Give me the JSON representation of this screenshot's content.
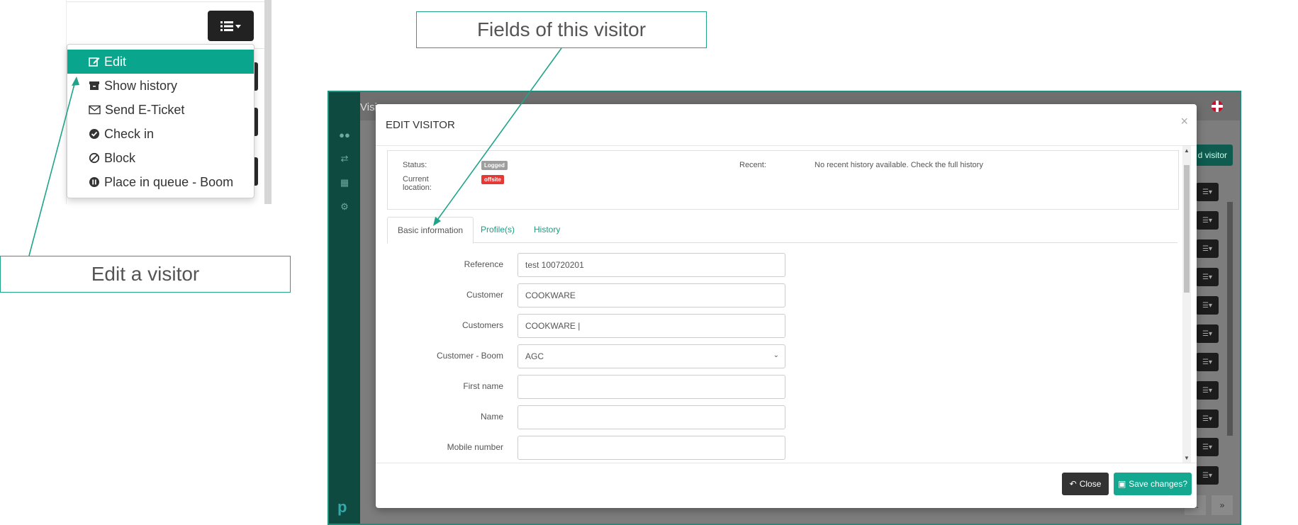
{
  "dropdown": {
    "items": [
      {
        "label": "Edit",
        "icon": "edit-icon"
      },
      {
        "label": "Show history",
        "icon": "archive-icon"
      },
      {
        "label": "Send E-Ticket",
        "icon": "envelope-icon"
      },
      {
        "label": "Check in",
        "icon": "check-circle-icon"
      },
      {
        "label": "Block",
        "icon": "ban-icon"
      },
      {
        "label": "Place in queue - Boom",
        "icon": "pause-circle-icon"
      }
    ]
  },
  "annotations": {
    "edit_visitor": "Edit a visitor",
    "fields_visitor": "Fields of this visitor"
  },
  "app": {
    "title": "Visi",
    "add_visitor": "d visitor",
    "pager_next": "»",
    "pager_ellipsis": "..."
  },
  "modal": {
    "title": "EDIT VISITOR",
    "close_symbol": "×",
    "status": {
      "status_label": "Status:",
      "status_badge": "Logged",
      "location_label": "Current location:",
      "location_badge": "offsite",
      "recent_label": "Recent:",
      "recent_text": "No recent history available. Check the full history"
    },
    "tabs": [
      {
        "label": "Basic information",
        "active": true
      },
      {
        "label": "Profile(s)",
        "active": false
      },
      {
        "label": "History",
        "active": false
      }
    ],
    "fields": [
      {
        "label": "Reference",
        "value": "test 100720201"
      },
      {
        "label": "Customer",
        "value": "COOKWARE"
      },
      {
        "label": "Customers",
        "value": "COOKWARE |"
      },
      {
        "label": "Customer - Boom",
        "value": "AGC"
      },
      {
        "label": "First name",
        "value": ""
      },
      {
        "label": "Name",
        "value": ""
      },
      {
        "label": "Mobile number",
        "value": ""
      }
    ],
    "buttons": {
      "close": "Close",
      "save": "Save changes?"
    }
  },
  "colors": {
    "accent": "#0aa58d",
    "sidebar": "#0f4a40",
    "badge_logged": "#9e9e9e",
    "badge_offsite": "#e53935"
  }
}
